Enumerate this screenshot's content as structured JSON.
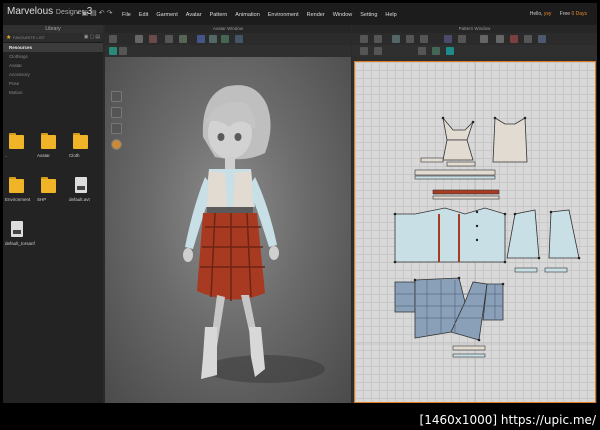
{
  "app": {
    "brand": "Marvelous",
    "brand_sub": "Designer",
    "brand_version": "3"
  },
  "menu": [
    "File",
    "Edit",
    "Garment",
    "Avatar",
    "Pattern",
    "Animation",
    "Environment",
    "Render",
    "Window",
    "Setting",
    "Help"
  ],
  "user": {
    "greeting": "Hello,",
    "name": "ysy",
    "plan": "Free",
    "days": "0 Days"
  },
  "library": {
    "title": "Library",
    "search_text": "FAVOURITE LIST",
    "nav": [
      {
        "label": "Resources",
        "active": true
      },
      {
        "label": "Clothings",
        "active": false
      },
      {
        "label": "Avatar",
        "active": false
      },
      {
        "label": "Accessory",
        "active": false
      },
      {
        "label": "Pose",
        "active": false
      },
      {
        "label": "Motion",
        "active": false
      }
    ],
    "items": [
      {
        "type": "folder",
        "label": ".."
      },
      {
        "type": "folder",
        "label": "Avatar"
      },
      {
        "type": "folder",
        "label": "Cloth"
      },
      {
        "type": "folder",
        "label": "Environment"
      },
      {
        "type": "folder",
        "label": "SHP"
      },
      {
        "type": "file",
        "label": "default.avt"
      },
      {
        "type": "file",
        "label": "default_torsanf"
      }
    ]
  },
  "avatar_window": {
    "title": "Avatar Window"
  },
  "pattern_window": {
    "title": "Pattern Window"
  },
  "colors": {
    "accent_orange": "#e07a20",
    "folder_yellow": "#f0b429",
    "plaid_red": "#a83a22",
    "plaid_blue": "#8a9fb8",
    "blouse": "#c9dfe6",
    "vest": "#e2dbd2"
  },
  "watermark": "[1460x1000] https://upic.me/"
}
